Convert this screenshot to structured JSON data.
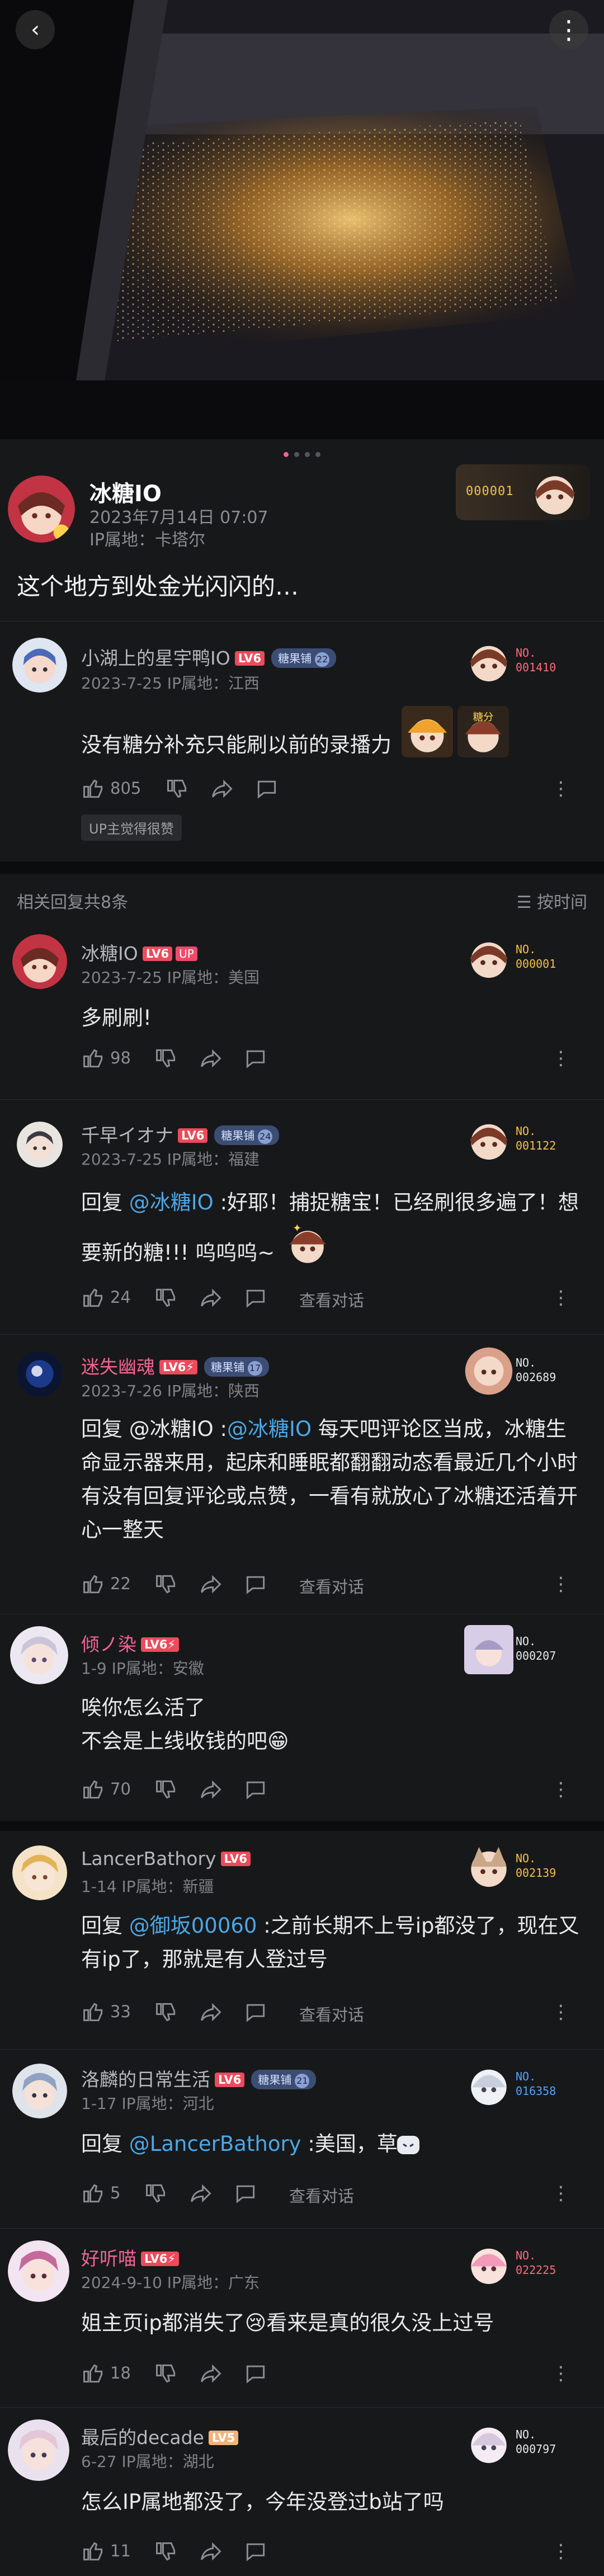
{
  "topbar": {
    "back_icon": "chevron-left-icon",
    "more_icon": "more-vertical-icon"
  },
  "gallery": {
    "pages": 4,
    "active_index": 0
  },
  "post": {
    "author": "冰糖IO",
    "time": "2023年7月14日 07:07",
    "ip": "IP属地：卡塔尔",
    "fan_number": "000001",
    "text": "这个地方到处金光闪闪的…"
  },
  "main_comment": {
    "user": "小湖上的星宇鸭IO",
    "level": "LV6",
    "medal": "糖果铺",
    "medal_level": "22",
    "meta": "2023-7-25  IP属地：江西",
    "text": "没有糖分补充只能刷以前的录播力",
    "likes": "805",
    "up_tag": "UP主觉得很赞",
    "badge_no": "NO.",
    "badge_num": "001410"
  },
  "reply_header": {
    "label": "相关回复共8条",
    "sort": "按时间",
    "sort_icon": "list-icon"
  },
  "replies": [
    {
      "user": "冰糖IO",
      "level": "LV6",
      "up": "UP",
      "meta": "2023-7-25  IP属地：美国",
      "text": "多刷刷!",
      "likes": "98",
      "badge_no": "NO.",
      "badge_num": "000001"
    },
    {
      "user": "千早イオナ",
      "level": "LV6",
      "medal": "糖果铺",
      "medal_level": "24",
      "meta": "2023-7-25  IP属地：福建",
      "prefix": "回复 ",
      "mention": "@冰糖IO",
      "text": " :好耶！捕捉糖宝！已经刷很多遍了！想要新的糖!!!  呜呜呜~",
      "likes": "24",
      "conv": "查看对话",
      "badge_no": "NO.",
      "badge_num": "001122"
    },
    {
      "user": "迷失幽魂",
      "level": "LV6⚡",
      "medal": "糖果铺",
      "medal_level": "17",
      "meta": "2023-7-26  IP属地：陕西",
      "prefix": "回复 @冰糖IO :",
      "mention": "@冰糖IO",
      "text": " 每天吧评论区当成，冰糖生命显示器来用，起床和睡眠都翻翻动态看最近几个小时有没有回复评论或点赞，一看有就放心了冰糖还活着开心一整天",
      "likes": "22",
      "conv": "查看对话",
      "badge_no": "NO.",
      "badge_num": "002689"
    },
    {
      "user": "倾ノ染",
      "level": "LV6⚡",
      "meta": "1-9  IP属地：安徽",
      "line1": "唉你怎么活了",
      "line2": "不会是上线收钱的吧😁",
      "likes": "70",
      "badge_no": "NO.",
      "badge_num": "000207"
    },
    {
      "user": "LancerBathory",
      "level": "LV6",
      "meta": "1-14  IP属地：新疆",
      "prefix": "回复 ",
      "mention": "@御坂00060",
      "text": " :之前长期不上号ip都没了，现在又有ip了，那就是有人登过号",
      "likes": "33",
      "conv": "查看对话",
      "badge_no": "NO.",
      "badge_num": "002139"
    },
    {
      "user": "洛麟的日常生活",
      "level": "LV6",
      "medal": "糖果铺",
      "medal_level": "21",
      "meta": "1-17  IP属地：河北",
      "prefix": "回复 ",
      "mention": "@LancerBathory",
      "text": " :美国，草",
      "likes": "5",
      "conv": "查看对话",
      "badge_no": "NO.",
      "badge_num": "016358"
    },
    {
      "user": "好听喵",
      "level": "LV6⚡",
      "meta": "2024-9-10  IP属地：广东",
      "text": "姐主页ip都消失了😢看来是真的很久没上过号",
      "likes": "18",
      "badge_no": "NO.",
      "badge_num": "022225"
    },
    {
      "user": "最后的decade",
      "level": "LV5",
      "meta": "6-27  IP属地：湖北",
      "text": "怎么IP属地都没了，今年没登过b站了吗",
      "likes": "11",
      "badge_no": "NO.",
      "badge_num": "000797"
    }
  ],
  "colors": {
    "background": "#17181a",
    "accent_pink": "#f0648f",
    "mention_blue": "#4ca7e6",
    "level_red": "#ee4a5c",
    "gold": "#f5c04a"
  }
}
